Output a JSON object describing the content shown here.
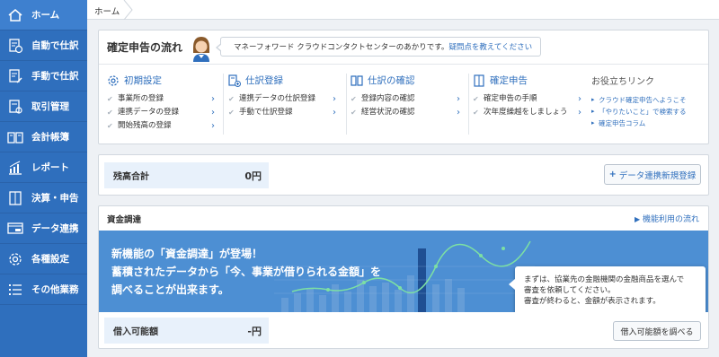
{
  "sidebar": {
    "items": [
      {
        "label": "ホーム",
        "icon": "home-icon"
      },
      {
        "label": "自動で仕訳",
        "icon": "auto-journal-icon"
      },
      {
        "label": "手動で仕訳",
        "icon": "manual-journal-icon"
      },
      {
        "label": "取引管理",
        "icon": "transaction-icon"
      },
      {
        "label": "会計帳簿",
        "icon": "ledger-book-icon"
      },
      {
        "label": "レポート",
        "icon": "report-chart-icon"
      },
      {
        "label": "決算・申告",
        "icon": "filing-icon"
      },
      {
        "label": "データ連携",
        "icon": "data-link-icon"
      },
      {
        "label": "各種設定",
        "icon": "gear-icon"
      },
      {
        "label": "その他業務",
        "icon": "list-icon"
      }
    ]
  },
  "breadcrumb": {
    "home": "ホーム"
  },
  "kakutei": {
    "title": "確定申告の流れ",
    "bubble_text": "マネーフォワード クラウドコンタクトセンターのあかりです。",
    "bubble_link": "疑問点を教えてください",
    "columns": [
      {
        "heading": "初期設定",
        "items": [
          "事業所の登録",
          "連携データの登録",
          "開始残高の登録"
        ]
      },
      {
        "heading": "仕訳登録",
        "items": [
          "連携データの仕訳登録",
          "手動で仕訳登録"
        ]
      },
      {
        "heading": "仕訳の確認",
        "items": [
          "登録内容の確認",
          "経営状況の確認"
        ]
      },
      {
        "heading": "確定申告",
        "items": [
          "確定申告の手順",
          "次年度繰越をしましょう"
        ]
      }
    ],
    "help": {
      "heading": "お役立ちリンク",
      "links": [
        "クラウド確定申告へようこそ",
        "「やりたいこと」で検索する",
        "確定申告コラム"
      ]
    }
  },
  "balance": {
    "label": "残高合計",
    "value": "0円",
    "add_button": "データ連携新規登録",
    "add_button_prefix": "+"
  },
  "funding": {
    "title": "資金調達",
    "flow_link": "機能利用の流れ",
    "banner_lines": [
      "新機能の「資金調達」が登場！",
      "蓄積されたデータから「今、事業が借りられる金額」を",
      "調べることが出来ます。"
    ],
    "tooltip_lines": [
      "まずは、協業先の金融機関の金融商品を選んで",
      "審査を依頼してください。",
      "審査が終わると、金額が表示されます。"
    ],
    "loan_label": "借入可能額",
    "loan_value": "-円",
    "check_button": "借入可能額を調べる"
  },
  "colors": {
    "sidebar": "#2f6fbd",
    "accent": "#2f6fbd",
    "banner": "#4d8fd3"
  }
}
